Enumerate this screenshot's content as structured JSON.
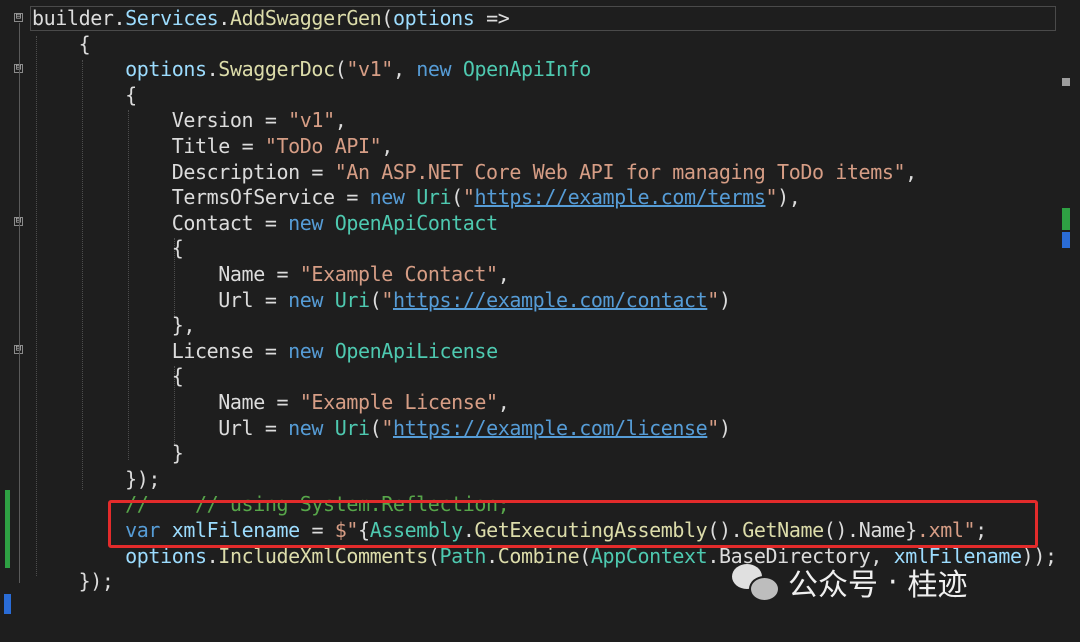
{
  "code_lines": [
    {
      "segments": [
        {
          "t": "builder.",
          "c": "v"
        },
        {
          "t": "Services",
          "c": "p"
        },
        {
          "t": ".",
          "c": "v"
        },
        {
          "t": "AddSwaggerGen",
          "c": "m"
        },
        {
          "t": "(",
          "c": "v"
        },
        {
          "t": "options",
          "c": "p"
        },
        {
          "t": " =>",
          "c": "v"
        }
      ]
    },
    {
      "segments": [
        {
          "t": "    {",
          "c": "v"
        }
      ]
    },
    {
      "segments": [
        {
          "t": "        ",
          "c": "v"
        },
        {
          "t": "options",
          "c": "p"
        },
        {
          "t": ".",
          "c": "v"
        },
        {
          "t": "SwaggerDoc",
          "c": "m"
        },
        {
          "t": "(",
          "c": "v"
        },
        {
          "t": "\"v1\"",
          "c": "s"
        },
        {
          "t": ", ",
          "c": "v"
        },
        {
          "t": "new",
          "c": "k"
        },
        {
          "t": " ",
          "c": "v"
        },
        {
          "t": "OpenApiInfo",
          "c": "t"
        }
      ]
    },
    {
      "segments": [
        {
          "t": "        {",
          "c": "v"
        }
      ]
    },
    {
      "segments": [
        {
          "t": "            ",
          "c": "v"
        },
        {
          "t": "Version",
          "c": "v"
        },
        {
          "t": " = ",
          "c": "v"
        },
        {
          "t": "\"v1\"",
          "c": "s"
        },
        {
          "t": ",",
          "c": "v"
        }
      ]
    },
    {
      "segments": [
        {
          "t": "            ",
          "c": "v"
        },
        {
          "t": "Title",
          "c": "v"
        },
        {
          "t": " = ",
          "c": "v"
        },
        {
          "t": "\"ToDo API\"",
          "c": "s"
        },
        {
          "t": ",",
          "c": "v"
        }
      ]
    },
    {
      "segments": [
        {
          "t": "            ",
          "c": "v"
        },
        {
          "t": "Description",
          "c": "v"
        },
        {
          "t": " = ",
          "c": "v"
        },
        {
          "t": "\"An ASP.NET Core Web API for managing ToDo items\"",
          "c": "s"
        },
        {
          "t": ",",
          "c": "v"
        }
      ]
    },
    {
      "segments": [
        {
          "t": "            ",
          "c": "v"
        },
        {
          "t": "TermsOfService",
          "c": "v"
        },
        {
          "t": " = ",
          "c": "v"
        },
        {
          "t": "new",
          "c": "k"
        },
        {
          "t": " ",
          "c": "v"
        },
        {
          "t": "Uri",
          "c": "t"
        },
        {
          "t": "(",
          "c": "v"
        },
        {
          "t": "\"",
          "c": "s"
        },
        {
          "t": "https://example.com/terms",
          "c": "u"
        },
        {
          "t": "\"",
          "c": "s"
        },
        {
          "t": "),",
          "c": "v"
        }
      ]
    },
    {
      "segments": [
        {
          "t": "            ",
          "c": "v"
        },
        {
          "t": "Contact",
          "c": "v"
        },
        {
          "t": " = ",
          "c": "v"
        },
        {
          "t": "new",
          "c": "k"
        },
        {
          "t": " ",
          "c": "v"
        },
        {
          "t": "OpenApiContact",
          "c": "t"
        }
      ]
    },
    {
      "segments": [
        {
          "t": "            {",
          "c": "v"
        }
      ]
    },
    {
      "segments": [
        {
          "t": "                ",
          "c": "v"
        },
        {
          "t": "Name",
          "c": "v"
        },
        {
          "t": " = ",
          "c": "v"
        },
        {
          "t": "\"Example Contact\"",
          "c": "s"
        },
        {
          "t": ",",
          "c": "v"
        }
      ]
    },
    {
      "segments": [
        {
          "t": "                ",
          "c": "v"
        },
        {
          "t": "Url",
          "c": "v"
        },
        {
          "t": " = ",
          "c": "v"
        },
        {
          "t": "new",
          "c": "k"
        },
        {
          "t": " ",
          "c": "v"
        },
        {
          "t": "Uri",
          "c": "t"
        },
        {
          "t": "(",
          "c": "v"
        },
        {
          "t": "\"",
          "c": "s"
        },
        {
          "t": "https://example.com/contact",
          "c": "u"
        },
        {
          "t": "\"",
          "c": "s"
        },
        {
          "t": ")",
          "c": "v"
        }
      ]
    },
    {
      "segments": [
        {
          "t": "            },",
          "c": "v"
        }
      ]
    },
    {
      "segments": [
        {
          "t": "            ",
          "c": "v"
        },
        {
          "t": "License",
          "c": "v"
        },
        {
          "t": " = ",
          "c": "v"
        },
        {
          "t": "new",
          "c": "k"
        },
        {
          "t": " ",
          "c": "v"
        },
        {
          "t": "OpenApiLicense",
          "c": "t"
        }
      ]
    },
    {
      "segments": [
        {
          "t": "            {",
          "c": "v"
        }
      ]
    },
    {
      "segments": [
        {
          "t": "                ",
          "c": "v"
        },
        {
          "t": "Name",
          "c": "v"
        },
        {
          "t": " = ",
          "c": "v"
        },
        {
          "t": "\"Example License\"",
          "c": "s"
        },
        {
          "t": ",",
          "c": "v"
        }
      ]
    },
    {
      "segments": [
        {
          "t": "                ",
          "c": "v"
        },
        {
          "t": "Url",
          "c": "v"
        },
        {
          "t": " = ",
          "c": "v"
        },
        {
          "t": "new",
          "c": "k"
        },
        {
          "t": " ",
          "c": "v"
        },
        {
          "t": "Uri",
          "c": "t"
        },
        {
          "t": "(",
          "c": "v"
        },
        {
          "t": "\"",
          "c": "s"
        },
        {
          "t": "https://example.com/license",
          "c": "u"
        },
        {
          "t": "\"",
          "c": "s"
        },
        {
          "t": ")",
          "c": "v"
        }
      ]
    },
    {
      "segments": [
        {
          "t": "            }",
          "c": "v"
        }
      ]
    },
    {
      "segments": [
        {
          "t": "        });",
          "c": "v"
        }
      ]
    },
    {
      "segments": [
        {
          "t": "        ",
          "c": "v"
        },
        {
          "t": "//    // using System.Reflection;",
          "c": "c"
        }
      ]
    },
    {
      "segments": [
        {
          "t": "        ",
          "c": "v"
        },
        {
          "t": "var",
          "c": "k"
        },
        {
          "t": " ",
          "c": "v"
        },
        {
          "t": "xmlFilename",
          "c": "p"
        },
        {
          "t": " = ",
          "c": "v"
        },
        {
          "t": "$\"",
          "c": "s"
        },
        {
          "t": "{",
          "c": "v"
        },
        {
          "t": "Assembly",
          "c": "t"
        },
        {
          "t": ".",
          "c": "v"
        },
        {
          "t": "GetExecutingAssembly",
          "c": "m"
        },
        {
          "t": "().",
          "c": "v"
        },
        {
          "t": "GetName",
          "c": "m"
        },
        {
          "t": "().",
          "c": "v"
        },
        {
          "t": "Name",
          "c": "v"
        },
        {
          "t": "}",
          "c": "v"
        },
        {
          "t": ".xml\"",
          "c": "s"
        },
        {
          "t": ";",
          "c": "v"
        }
      ]
    },
    {
      "segments": [
        {
          "t": "        ",
          "c": "v"
        },
        {
          "t": "options",
          "c": "p"
        },
        {
          "t": ".",
          "c": "v"
        },
        {
          "t": "IncludeXmlComments",
          "c": "m"
        },
        {
          "t": "(",
          "c": "v"
        },
        {
          "t": "Path",
          "c": "t"
        },
        {
          "t": ".",
          "c": "v"
        },
        {
          "t": "Combine",
          "c": "m"
        },
        {
          "t": "(",
          "c": "v"
        },
        {
          "t": "AppContext",
          "c": "t"
        },
        {
          "t": ".",
          "c": "v"
        },
        {
          "t": "BaseDirectory",
          "c": "v"
        },
        {
          "t": ", ",
          "c": "v"
        },
        {
          "t": "xmlFilename",
          "c": "p"
        },
        {
          "t": "));",
          "c": "v"
        }
      ]
    },
    {
      "segments": [
        {
          "t": "    });",
          "c": "v"
        }
      ]
    }
  ],
  "fold_markers": [
    "⊟",
    "⊟",
    "⊟",
    "⊟"
  ],
  "watermark": {
    "platform": "公众号",
    "separator": "·",
    "author": "桂迹"
  },
  "colors": {
    "background": "#1e1e1e",
    "keyword": "#569cd6",
    "type": "#4ec9b0",
    "method": "#dcdcaa",
    "string": "#d69d85",
    "comment": "#57a64a",
    "highlight_box": "#e32b2b",
    "change_bar": "#2ea043"
  },
  "icons": {
    "fold": "collapse-box-icon",
    "watermark": "wechat-icon"
  }
}
